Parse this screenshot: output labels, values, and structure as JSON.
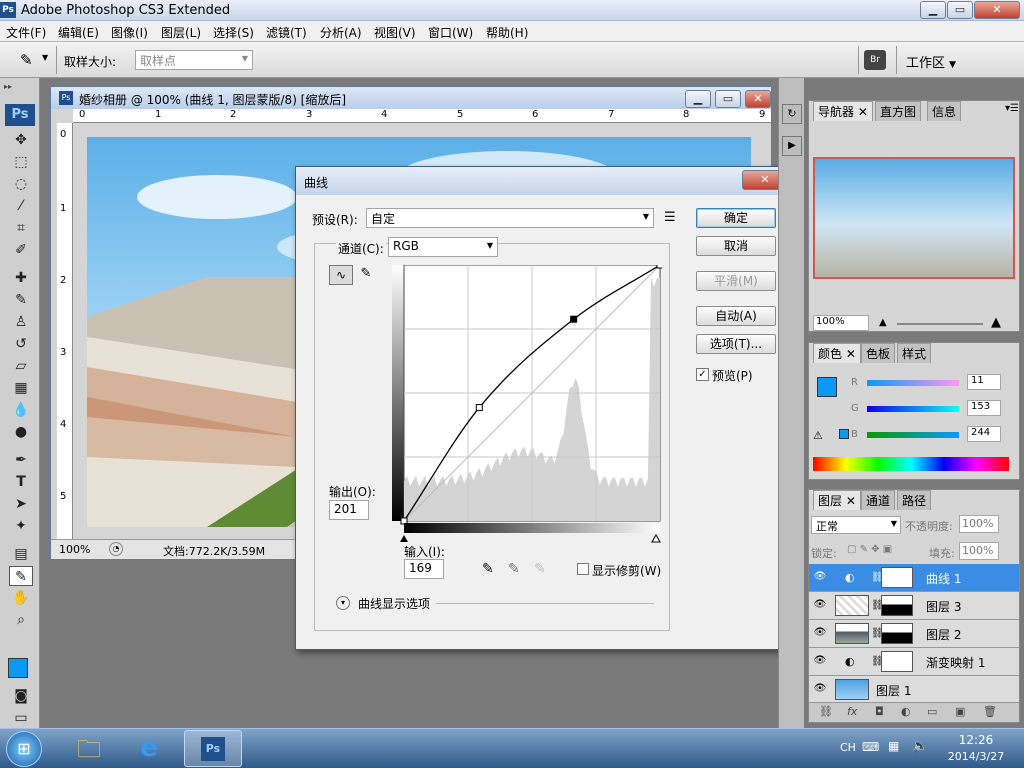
{
  "window": {
    "title": "Adobe Photoshop CS3 Extended",
    "badge": "Ps"
  },
  "menubar": {
    "items": [
      "文件(F)",
      "编辑(E)",
      "图像(I)",
      "图层(L)",
      "选择(S)",
      "滤镜(T)",
      "分析(A)",
      "视图(V)",
      "窗口(W)",
      "帮助(H)"
    ]
  },
  "options": {
    "sample_label": "取样大小:",
    "sample_value": "取样点",
    "workspace": "工作区"
  },
  "document": {
    "title": "婚纱相册 @ 100% (曲线 1, 图层蒙版/8) [缩放后]",
    "zoom": "100%",
    "doc_info": "文档:772.2K/3.59M",
    "ruler_top": [
      "0",
      "1",
      "2",
      "3",
      "4",
      "5",
      "6",
      "7",
      "8",
      "9"
    ],
    "ruler_left": [
      "0",
      "1",
      "2",
      "3",
      "4",
      "5"
    ]
  },
  "curves": {
    "title": "曲线",
    "preset_label": "预设(R):",
    "preset_value": "自定",
    "channel_label": "通道(C):",
    "channel_value": "RGB",
    "output_label": "输出(O):",
    "output_value": "201",
    "input_label": "输入(I):",
    "input_value": "169",
    "show_clipping": "显示修剪(W)",
    "display_options": "曲线显示选项",
    "buttons": {
      "ok": "确定",
      "cancel": "取消",
      "smooth": "平滑(M)",
      "auto": "自动(A)",
      "options": "选项(T)..."
    },
    "preview": "预览(P)",
    "points": [
      [
        0,
        0
      ],
      [
        75,
        113
      ],
      [
        169,
        201
      ],
      [
        255,
        255
      ]
    ]
  },
  "navigator": {
    "tabs": [
      "导航器",
      "直方图",
      "信息"
    ],
    "zoom": "100%"
  },
  "color": {
    "tabs": [
      "颜色",
      "色板",
      "样式"
    ],
    "r_label": "R",
    "g_label": "G",
    "b_label": "B",
    "r": 11,
    "g": 153,
    "b": 244,
    "fg": "#0b99f4"
  },
  "layers": {
    "tabs": [
      "图层",
      "通道",
      "路径"
    ],
    "blend": "正常",
    "opacity_label": "不透明度:",
    "opacity": "100%",
    "lock_label": "锁定:",
    "fill_label": "填充:",
    "fill": "100%",
    "items": [
      {
        "name": "曲线 1",
        "selected": true
      },
      {
        "name": "图层 3",
        "selected": false
      },
      {
        "name": "图层 2",
        "selected": false
      },
      {
        "name": "渐变映射 1",
        "selected": false
      },
      {
        "name": "图层 1",
        "selected": false
      }
    ]
  },
  "taskbar": {
    "lang": "CH",
    "time": "12:26",
    "date": "2014/3/27"
  }
}
